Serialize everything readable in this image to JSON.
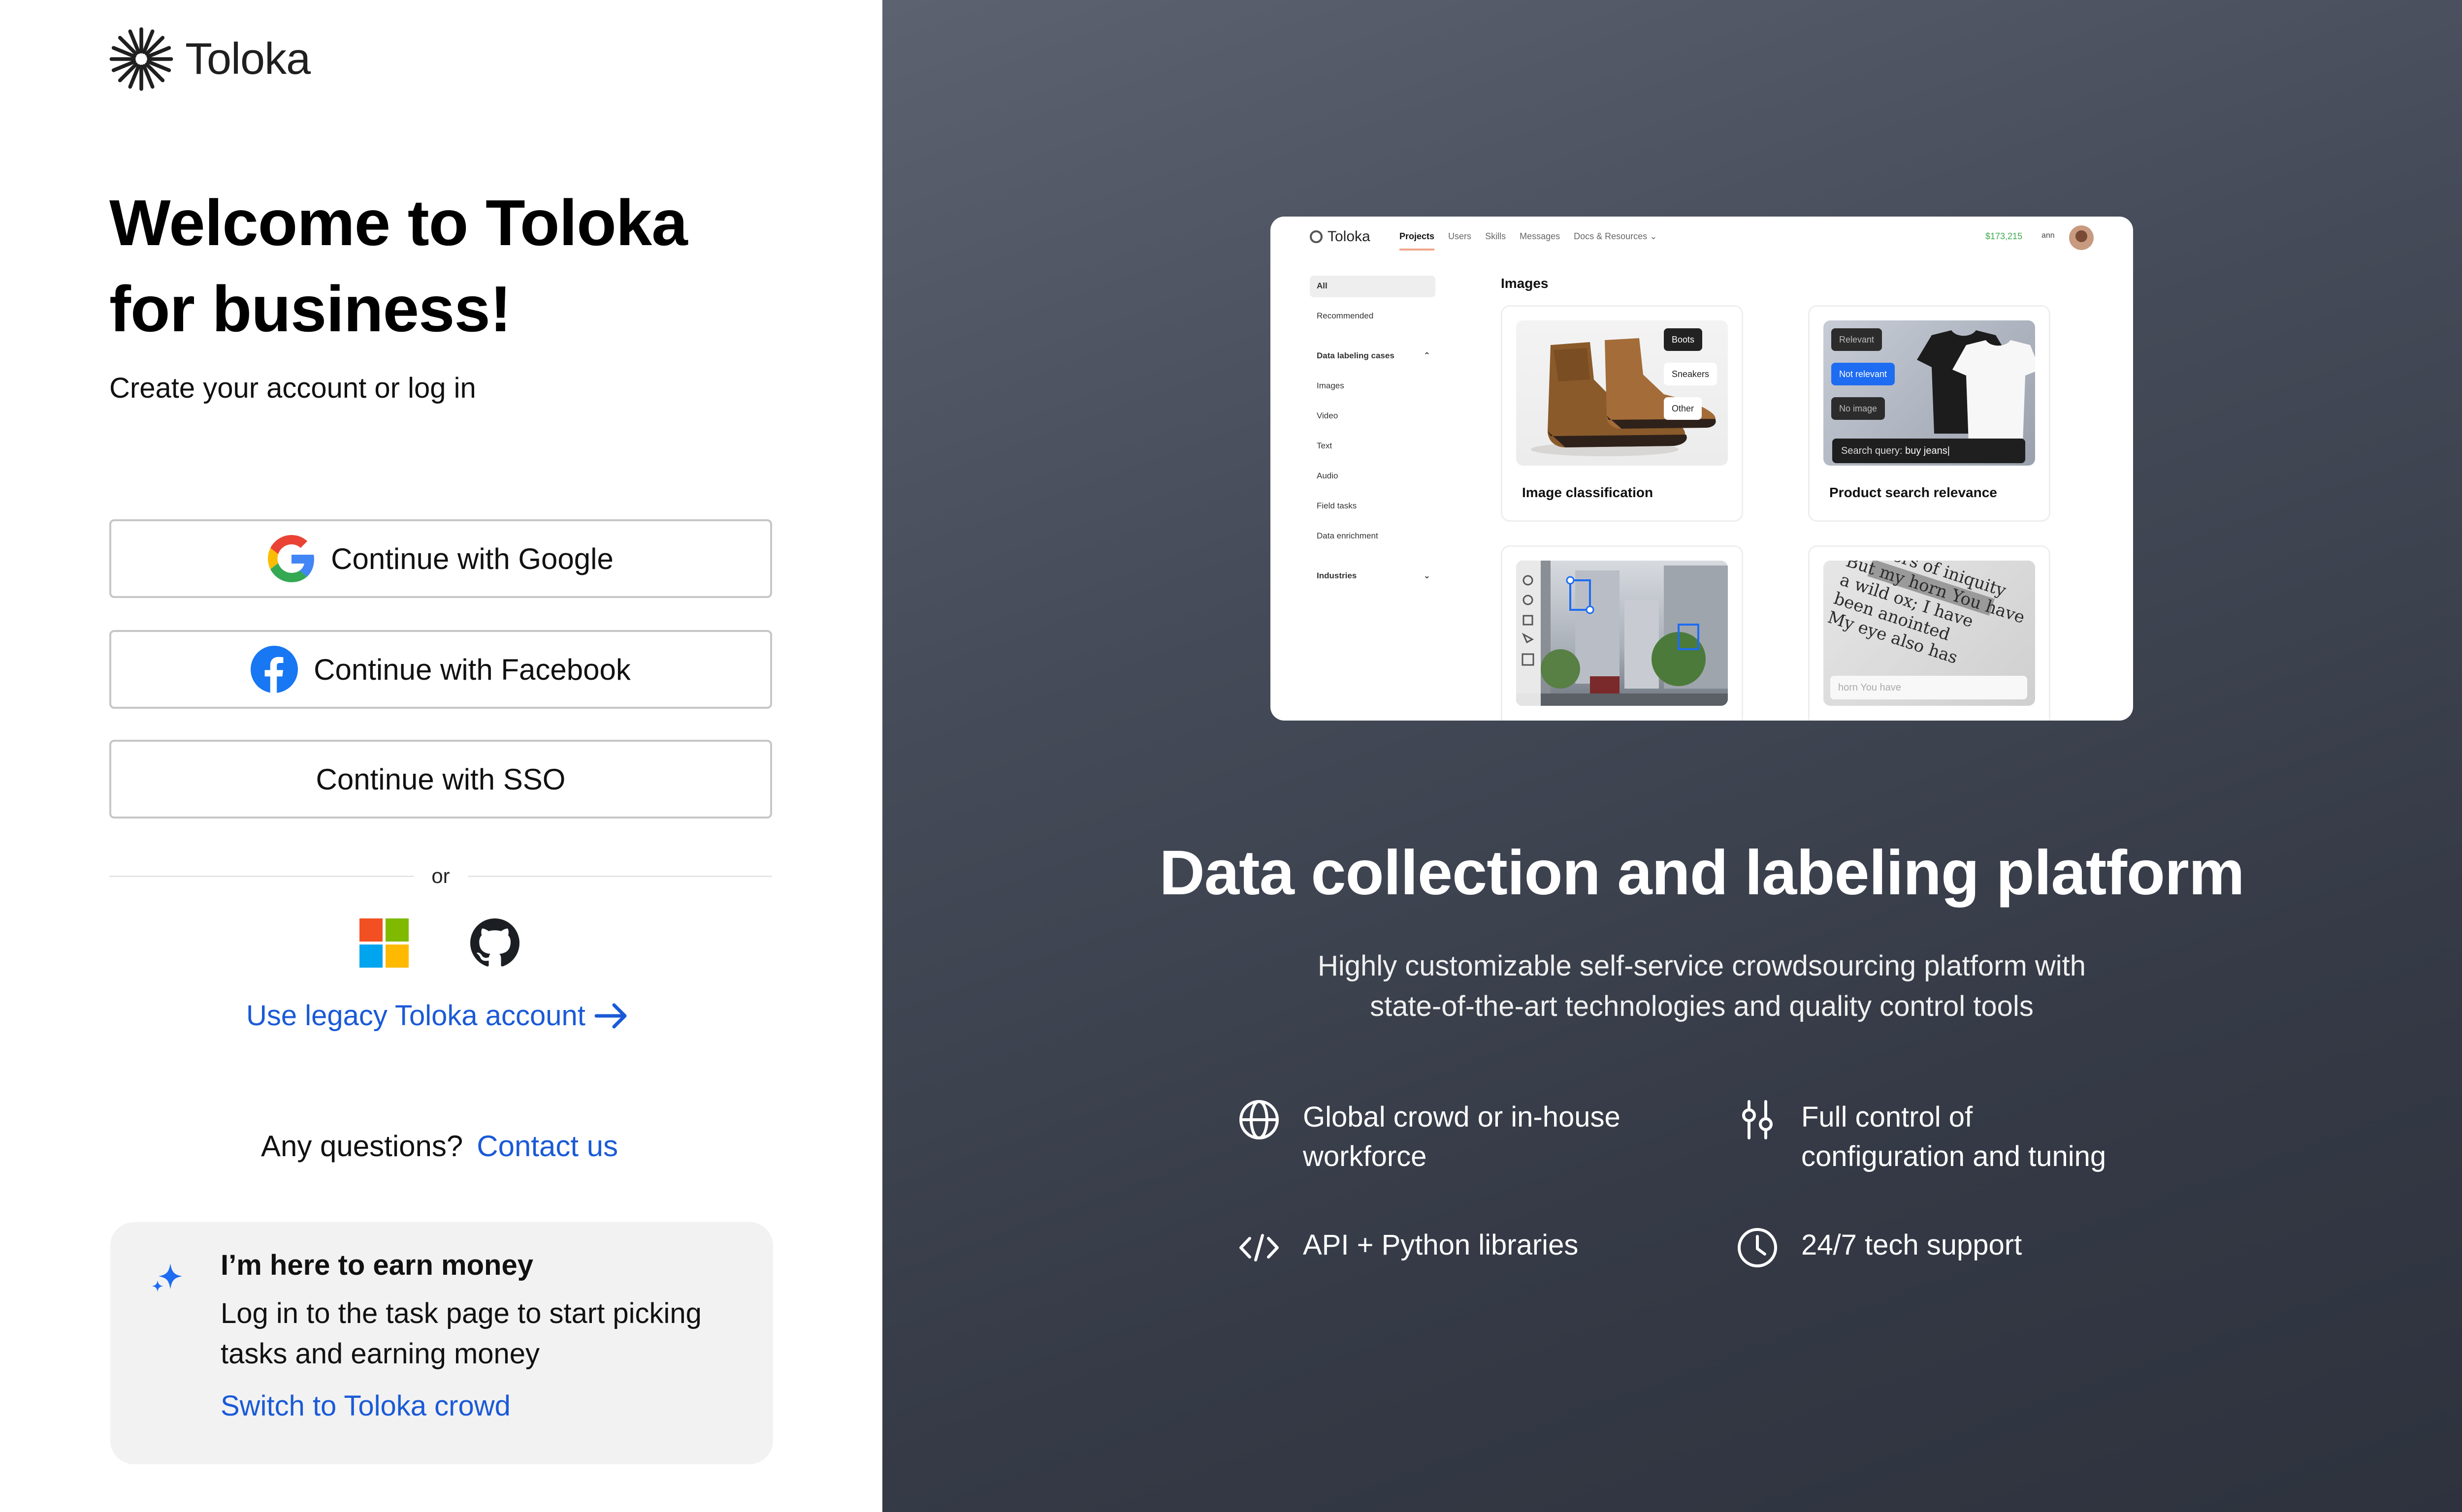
{
  "brand": {
    "name": "Toloka"
  },
  "welcome": {
    "title_line1": "Welcome to Toloka",
    "title_line2": "for business!",
    "subtitle": "Create your account or log in"
  },
  "auth": {
    "google": "Continue with Google",
    "facebook": "Continue with Facebook",
    "sso": "Continue with SSO",
    "or": "or",
    "alt_icons": [
      "microsoft-icon",
      "github-icon"
    ],
    "legacy": "Use legacy Toloka account"
  },
  "questions": {
    "text": "Any questions?",
    "link": "Contact us"
  },
  "earn": {
    "title": "I’m here to earn money",
    "body": "Log in to the task page to start picking tasks and earning money",
    "link": "Switch to Toloka crowd"
  },
  "preview": {
    "logo": "Toloka",
    "nav": [
      "Projects",
      "Users",
      "Skills",
      "Messages",
      "Docs & Resources"
    ],
    "balance": "$173,215",
    "user": "ann",
    "sidebar": {
      "all": "All",
      "recommended": "Recommended",
      "group_cases": "Data labeling cases",
      "cases": [
        "Images",
        "Video",
        "Text",
        "Audio",
        "Field tasks",
        "Data enrichment"
      ],
      "group_industries": "Industries"
    },
    "main_title": "Images",
    "cards": [
      {
        "label": "Image classification",
        "tags": [
          "Boots",
          "Sneakers",
          "Other"
        ]
      },
      {
        "label": "Product search relevance",
        "tags": [
          "Relevant",
          "Not relevant",
          "No image"
        ],
        "search_label": "Search query:",
        "search_value": "buy jeans|"
      },
      {
        "label": ""
      },
      {
        "label": ""
      }
    ],
    "text_snippet": "horn You have"
  },
  "hero": {
    "title": "Data collection and labeling platform",
    "tagline_line1": "Highly customizable self-service crowdsourcing platform with",
    "tagline_line2": "state-of-the-art technologies and quality control tools"
  },
  "features": [
    {
      "icon": "globe-icon",
      "line1": "Global crowd or in-house",
      "line2": "workforce"
    },
    {
      "icon": "sliders-icon",
      "line1": "Full control of",
      "line2": "configuration and tuning"
    },
    {
      "icon": "code-icon",
      "line1": "API + Python libraries",
      "line2": ""
    },
    {
      "icon": "clock-icon",
      "line1": "24/7 tech support",
      "line2": ""
    }
  ],
  "colors": {
    "link": "#1a5ad7",
    "right_panel": "#353a46",
    "balance": "#3caa4f",
    "accent_blue": "#1e6cf2"
  }
}
